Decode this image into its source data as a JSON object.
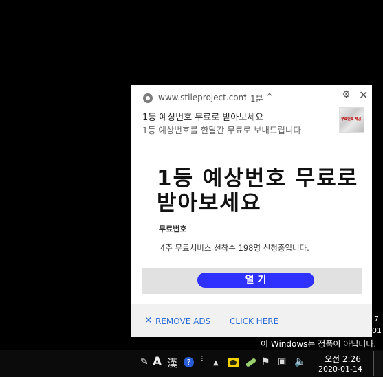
{
  "notification": {
    "origin": "www.stileproject.com",
    "dot": "•",
    "age": "1분",
    "title": "1등 예상번호 무료로 받아보세요",
    "message": "1등 예상번호를 한달간 무료로 보내드립니다",
    "thumb_text": "무료번호 제공",
    "ad": {
      "headline_line1": "1등 예상번호 무료로",
      "headline_line2": "받아보세요",
      "subtitle": "무료번호",
      "body": "4주 무료서비스 선착순 198명 신청중입니다.",
      "button_label": "열 기"
    },
    "footer": {
      "remove_ads": "REMOVE ADS",
      "click_here": "CLICK HERE"
    }
  },
  "desktop": {
    "edge_text_1": "7",
    "edge_text_2": "01",
    "watermark": "이 Windows는 정품이 아닙니다."
  },
  "taskbar": {
    "ime_mode": "A",
    "hanja": "漢",
    "help": "?",
    "time": "오전 2:26",
    "date": "2020-01-14"
  },
  "colors": {
    "open_button": "#2f31ff",
    "link": "#2b6fd6",
    "footer_bg": "#f1f1f1",
    "button_area_bg": "#e1e1e1"
  }
}
